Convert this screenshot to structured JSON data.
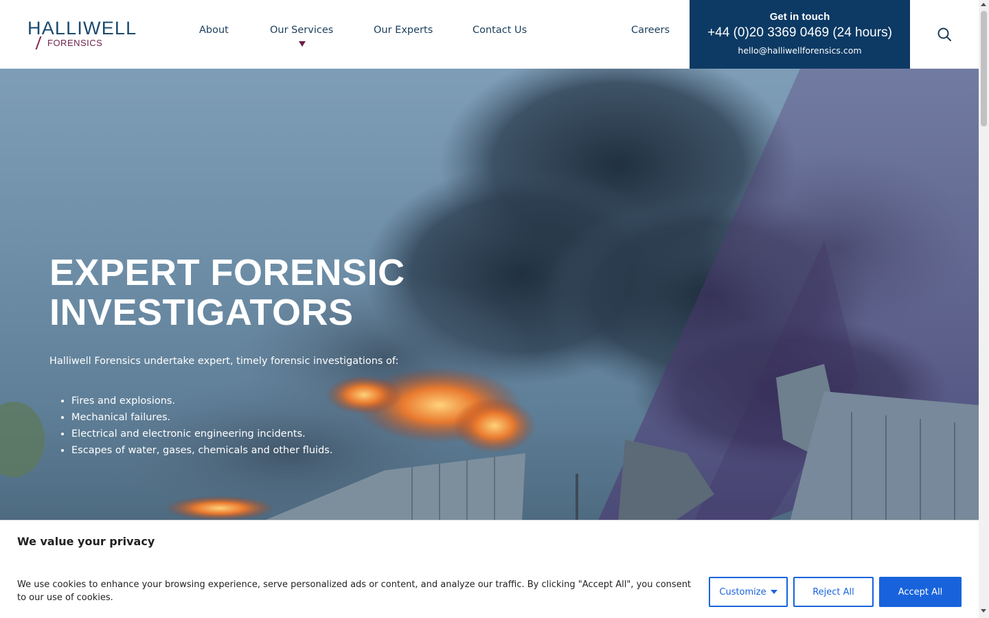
{
  "brand": {
    "name": "HALLIWELL",
    "sub": "FORENSICS"
  },
  "nav": {
    "items": [
      {
        "label": "About"
      },
      {
        "label": "Our Services"
      },
      {
        "label": "Our Experts"
      },
      {
        "label": "Contact Us"
      },
      {
        "label": "Careers"
      }
    ]
  },
  "contact": {
    "title": "Get in touch",
    "phone": "+44 (0)20 3369 0469 (24 hours)",
    "email": "hello@halliwellforensics.com"
  },
  "hero": {
    "title_line1": "EXPERT FORENSIC",
    "title_line2": "INVESTIGATORS",
    "intro": "Halliwell Forensics undertake expert, timely forensic investigations of:",
    "list": [
      "Fires and explosions.",
      "Mechanical failures.",
      "Electrical and electronic engineering incidents.",
      "Escapes of water, gases, chemicals and other fluids."
    ]
  },
  "cookie": {
    "title": "We value your privacy",
    "text": "We use cookies to enhance your browsing experience, serve personalized ads or content, and analyze our traffic. By clicking \"Accept All\", you consent to our use of cookies.",
    "customize_label": "Customize",
    "reject_label": "Reject All",
    "accept_label": "Accept All"
  },
  "colors": {
    "brand_navy": "#0c3a64",
    "brand_plum": "#6b1f4a",
    "cookie_blue": "#1863dc"
  },
  "icons": {
    "search": "search-icon",
    "dropdown": "chevron-down-icon"
  }
}
